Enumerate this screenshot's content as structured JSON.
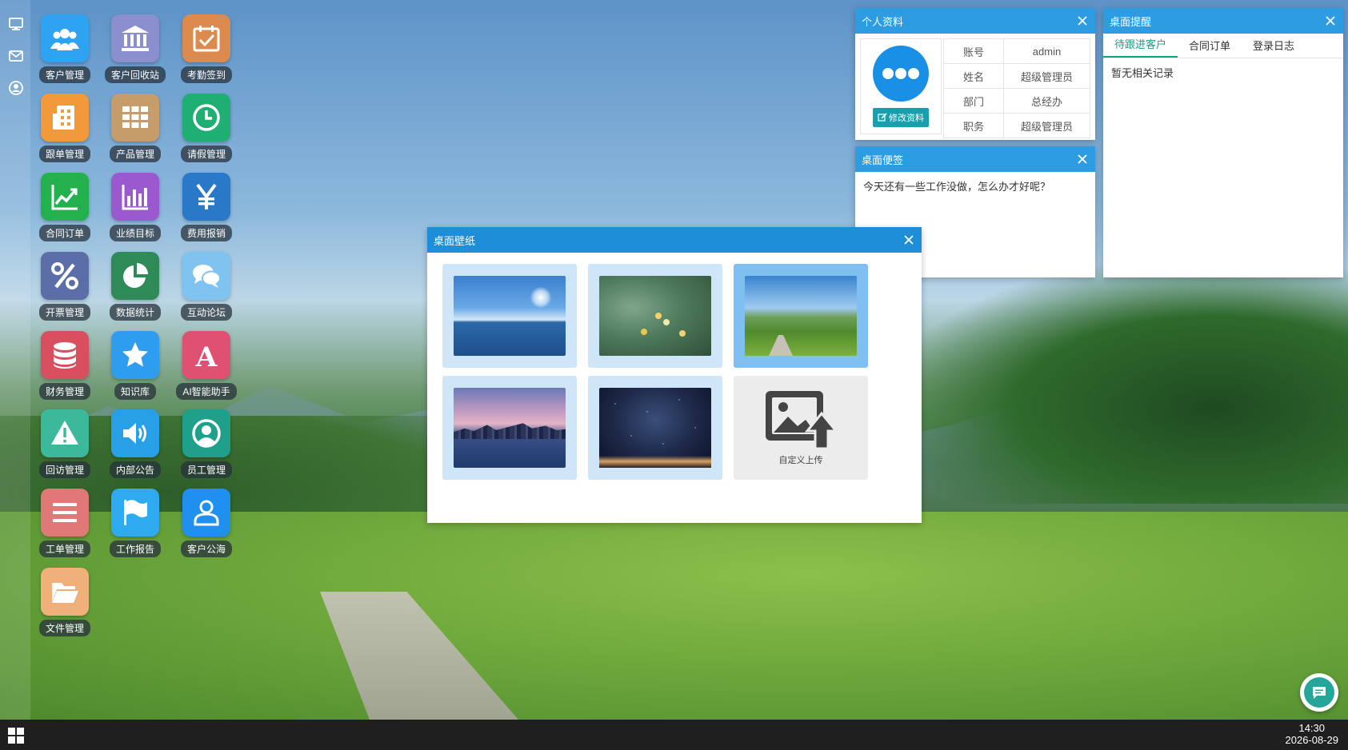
{
  "desktop": {
    "apps": [
      {
        "label": "客户管理",
        "icon": "users-icon",
        "color": "#2ea3f2"
      },
      {
        "label": "客户回收站",
        "icon": "bank-icon",
        "color": "#8b8fce"
      },
      {
        "label": "考勤签到",
        "icon": "calendar-check-icon",
        "color": "#dc8a4e"
      },
      {
        "label": "跟单管理",
        "icon": "building-icon",
        "color": "#f29a3a"
      },
      {
        "label": "产品管理",
        "icon": "grid-icon",
        "color": "#c59c6a"
      },
      {
        "label": "请假管理",
        "icon": "clock-icon",
        "color": "#1fae73"
      },
      {
        "label": "合同订单",
        "icon": "chart-line-icon",
        "color": "#22b14c"
      },
      {
        "label": "业绩目标",
        "icon": "bar-chart-icon",
        "color": "#9b59d0"
      },
      {
        "label": "费用报销",
        "icon": "yen-icon",
        "color": "#2a78c8"
      },
      {
        "label": "开票管理",
        "icon": "percent-icon",
        "color": "#5b6ea8"
      },
      {
        "label": "数据统计",
        "icon": "pie-chart-icon",
        "color": "#2e8b57"
      },
      {
        "label": "互动论坛",
        "icon": "chat-bubbles-icon",
        "color": "#7fc4f0"
      },
      {
        "label": "财务管理",
        "icon": "database-icon",
        "color": "#d85060"
      },
      {
        "label": "知识库",
        "icon": "star-icon",
        "color": "#2e9df0"
      },
      {
        "label": "AI智能助手",
        "icon": "letter-a-icon",
        "color": "#e05070"
      },
      {
        "label": "回访管理",
        "icon": "warning-icon",
        "color": "#3cb99a"
      },
      {
        "label": "内部公告",
        "icon": "speaker-icon",
        "color": "#28a0e8"
      },
      {
        "label": "员工管理",
        "icon": "user-circle-icon",
        "color": "#1ea08a"
      },
      {
        "label": "工单管理",
        "icon": "list-icon",
        "color": "#e07878"
      },
      {
        "label": "工作报告",
        "icon": "flag-icon",
        "color": "#2eaaf0"
      },
      {
        "label": "客户公海",
        "icon": "user-outline-icon",
        "color": "#1f90f0"
      },
      {
        "label": "文件管理",
        "icon": "folder-open-icon",
        "color": "#f0b07a"
      }
    ]
  },
  "sidebar": {
    "icons": [
      "monitor-icon",
      "mail-icon",
      "user-icon"
    ]
  },
  "profile_window": {
    "title": "个人资料",
    "edit_button": "修改资料",
    "rows": [
      {
        "key": "账号",
        "value": "admin"
      },
      {
        "key": "姓名",
        "value": "超级管理员"
      },
      {
        "key": "部门",
        "value": "总经办"
      },
      {
        "key": "职务",
        "value": "超级管理员"
      }
    ]
  },
  "reminder_window": {
    "title": "桌面提醒",
    "tabs": [
      {
        "label": "待跟进客户",
        "active": true
      },
      {
        "label": "合同订单",
        "active": false
      },
      {
        "label": "登录日志",
        "active": false
      }
    ],
    "empty_text": "暂无相关记录"
  },
  "note_window": {
    "title": "桌面便签",
    "text": "今天还有一些工作没做，怎么办才好呢？"
  },
  "wallpaper_window": {
    "title": "桌面壁纸",
    "items": [
      {
        "name": "sea",
        "selected": false
      },
      {
        "name": "flower",
        "selected": false
      },
      {
        "name": "meadow",
        "selected": true
      },
      {
        "name": "city",
        "selected": false
      },
      {
        "name": "stars",
        "selected": false
      }
    ],
    "upload_label": "自定义上传"
  },
  "taskbar": {
    "time": "14:30",
    "date": "2026-08-29"
  },
  "colors": {
    "titlebar": "#2d9ce3",
    "tab_active": "#16a085",
    "taskbar": "#1f1f1f"
  }
}
